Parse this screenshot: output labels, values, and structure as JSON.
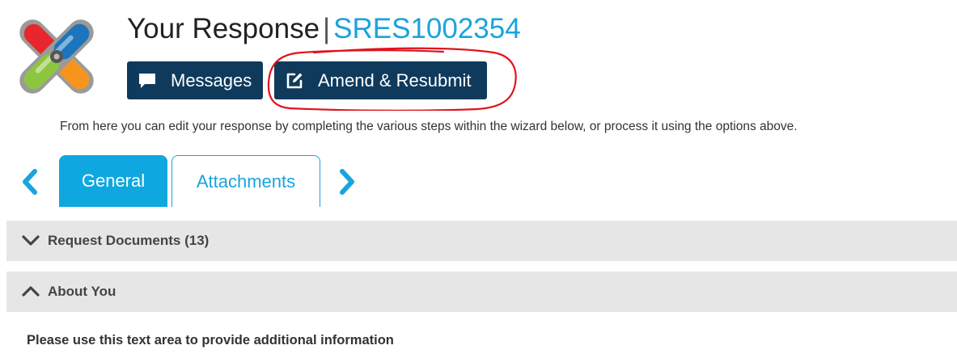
{
  "header": {
    "title": "Your Response",
    "separator": "|",
    "reference": "SRES1002354"
  },
  "actions": {
    "messages_label": "Messages",
    "amend_label": "Amend & Resubmit"
  },
  "instruction": "From here you can edit your response by completing the various steps within the wizard below, or process it using the options above.",
  "tabs": [
    {
      "label": "General",
      "active": true
    },
    {
      "label": "Attachments",
      "active": false
    }
  ],
  "sections": [
    {
      "label": "Request Documents (13)",
      "expanded": false
    },
    {
      "label": "About You",
      "expanded": true
    }
  ],
  "about_you": {
    "prompt": "Please use this text area to provide additional information"
  },
  "colors": {
    "accent": "#1aa3dd",
    "button_dark": "#0f3a5c",
    "panel_bg": "#e6e6e6",
    "annotation": "#e0121a"
  },
  "icons": {
    "messages": "speech-bubble-icon",
    "amend": "edit-pencil-icon",
    "prev": "chevron-left-icon",
    "next": "chevron-right-icon",
    "collapsed": "chevron-down-icon",
    "expanded": "chevron-up-icon"
  }
}
